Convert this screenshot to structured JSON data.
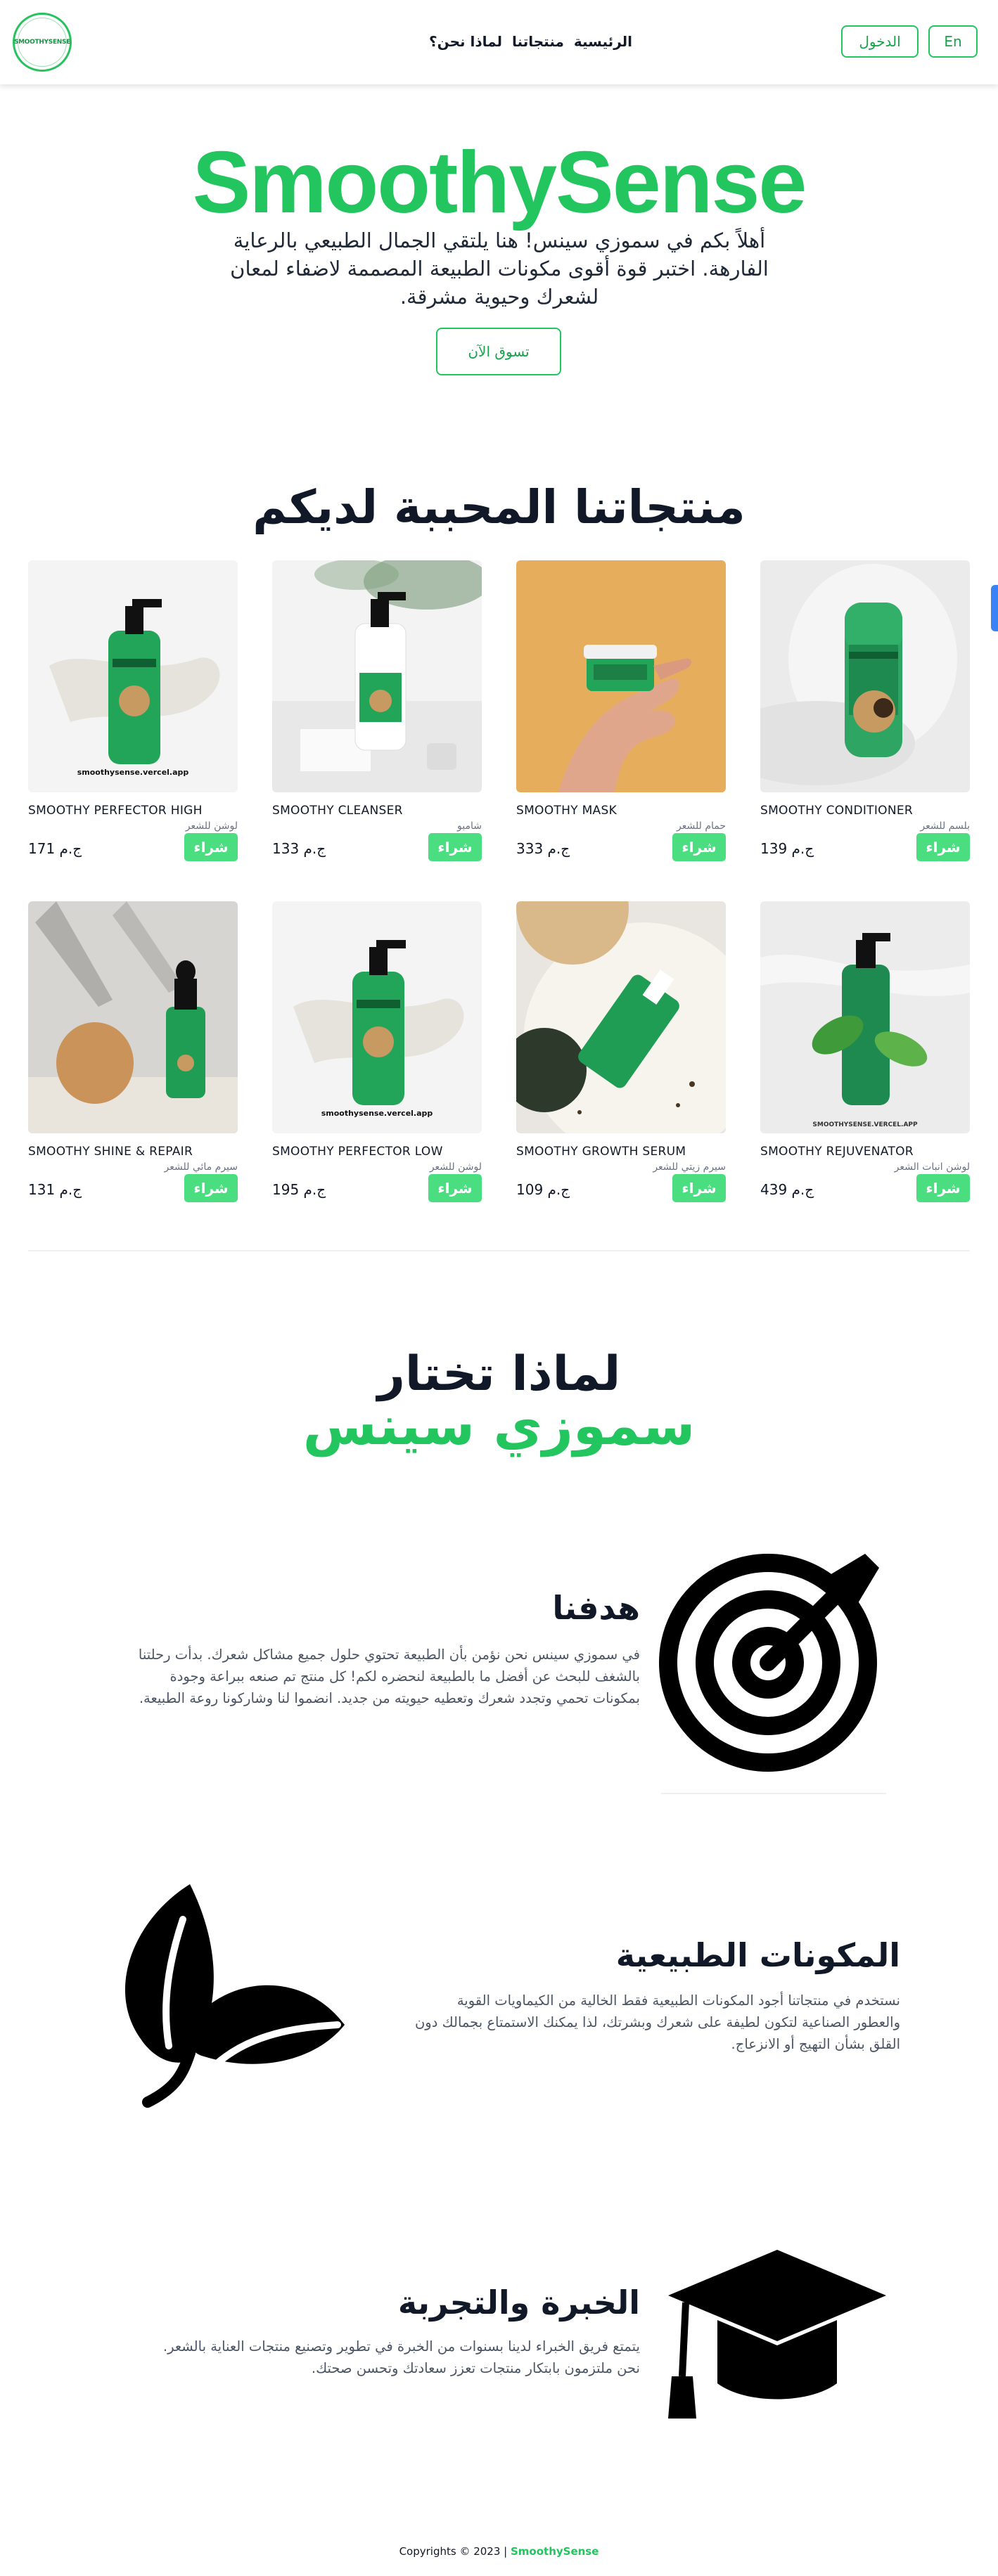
{
  "nav": {
    "logo_text": "SMOOTHYSENSE",
    "logo_sub": "Natural Hair Care",
    "links": [
      "الرئيسية",
      "منتجاتنا",
      "لماذا نحن؟"
    ],
    "lang_button": "En",
    "login_button": "الدخول"
  },
  "hero": {
    "title": "SmoothySense",
    "text": "أهلاً بكم في سموزي سينس! هنا يلتقي الجمال الطبيعي بالرعاية الفارهة. اختبر قوة أقوى مكونات الطبيعة المصممة لاضفاء لمعان لشعرك وحيوية مشرقة.",
    "button": "تسوق الآن"
  },
  "products": {
    "title": "منتجاتنا المحببة لديكم",
    "buy_label": "شراء",
    "items": [
      {
        "name": "SMOOTHY CONDITIONER",
        "category": "بلسم للشعر",
        "price": "139 ج.م",
        "image": "conditioner-bottle"
      },
      {
        "name": "SMOOTHY MASK",
        "category": "حمام للشعر",
        "price": "333 ج.م",
        "image": "mask-jar"
      },
      {
        "name": "SMOOTHY CLEANSER",
        "category": "شامبو",
        "price": "133 ج.م",
        "image": "cleanser-bottle"
      },
      {
        "name": "SMOOTHY PERFECTOR HIGH",
        "category": "لوشن للشعر",
        "price": "171 ج.م",
        "image": "pump-bottle",
        "watermark": "smoothysense.vercel.app"
      },
      {
        "name": "SMOOTHY REJUVENATOR",
        "category": "لوشن انبات الشعر",
        "price": "439 ج.م",
        "image": "rejuvenator-bottle",
        "watermark": "SMOOTHYSENSE.VERCEL.APP"
      },
      {
        "name": "SMOOTHY GROWTH SERUM",
        "category": "سيرم زيتي للشعر",
        "price": "109 ج.م",
        "image": "serum-dropper"
      },
      {
        "name": "SMOOTHY PERFECTOR LOW",
        "category": "لوشن للشعر",
        "price": "195 ج.م",
        "image": "pump-bottle",
        "watermark": "smoothysense.vercel.app"
      },
      {
        "name": "SMOOTHY SHINE & REPAIR",
        "category": "سيرم مائي للشعر",
        "price": "131 ج.م",
        "image": "shine-dropper"
      }
    ]
  },
  "why": {
    "title_line1": "لماذا تختار",
    "title_line2": "سموزي سينس",
    "features": [
      {
        "icon": "target-icon",
        "title": "هدفنا",
        "text": "في سموزي سينس نحن نؤمن بأن الطبيعة تحتوي حلول جميع مشاكل شعرك. بدأت رحلتنا بالشغف للبحث عن أفضل ما بالطبيعة لنحضره لكم! كل منتج تم صنعه ببراعة وجودة بمكونات تحمي وتجدد شعرك وتعطيه حيويته من جديد. انضموا لنا وشاركونا روعة الطبيعة."
      },
      {
        "icon": "leaf-icon",
        "title": "المكونات الطبيعية",
        "text": "نستخدم في منتجاتنا أجود المكونات الطبيعية فقط الخالية من الكيماويات القوية والعطور الصناعية لتكون لطيفة على شعرك وبشرتك، لذا يمكنك الاستمتاع بجمالك دون القلق بشأن التهيج أو الانزعاج."
      },
      {
        "icon": "graduation-cap-icon",
        "title": "الخبرة والتجربة",
        "text": "يتمتع فريق الخبراء لدينا بسنوات من الخبرة في تطوير وتصنيع منتجات العناية بالشعر. نحن ملتزمون بابتكار منتجات تعزز سعادتك وتحسن صحتك."
      }
    ]
  },
  "footer": {
    "copyright": "Copyrights © 2023 |",
    "brand": "SmoothySense"
  },
  "colors": {
    "brand_green": "#22c55e",
    "buy_button": "#4ade80",
    "product_green": "#1f9d55",
    "mask_background": "#e6ae5c"
  }
}
